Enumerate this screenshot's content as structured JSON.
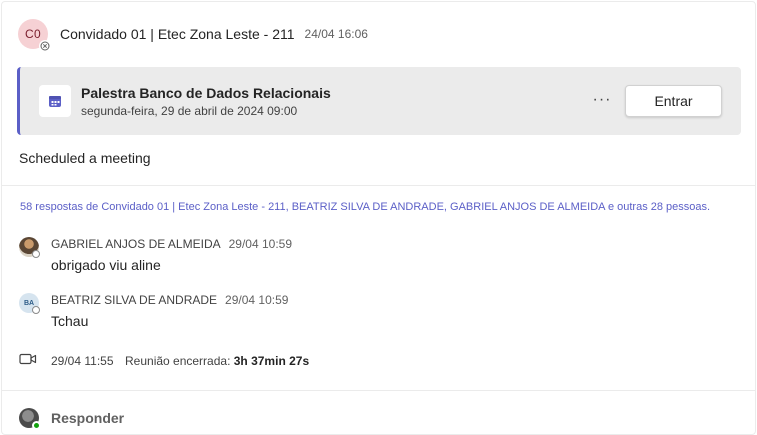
{
  "post": {
    "avatar_initials": "C0",
    "author": "Convidado 01 | Etec Zona Leste - 211",
    "timestamp": "24/04 16:06",
    "text": "Scheduled a meeting"
  },
  "meeting": {
    "title": "Palestra Banco de Dados Relacionais",
    "date": "segunda-feira, 29 de abril de 2024 09:00",
    "more_label": "···",
    "join_label": "Entrar"
  },
  "replies_summary": "58 respostas de Convidado 01 | Etec Zona Leste - 211, BEATRIZ SILVA DE ANDRADE, GABRIEL ANJOS DE ALMEIDA e outras 28 pessoas.",
  "replies": [
    {
      "author": "GABRIEL ANJOS DE ALMEIDA",
      "time": "29/04 10:59",
      "text": "obrigado viu aline",
      "avatar": "photo"
    },
    {
      "author": "BEATRIZ SILVA DE ANDRADE",
      "time": "29/04 10:59",
      "text": "Tchau",
      "avatar_initials": "BA"
    }
  ],
  "meeting_ended": {
    "time": "29/04 11:55",
    "label": "Reunião encerrada:",
    "duration": "3h 37min 27s"
  },
  "reply_bar": {
    "label": "Responder"
  },
  "colors": {
    "accent": "#5b5fc7",
    "online": "#13a10e"
  }
}
